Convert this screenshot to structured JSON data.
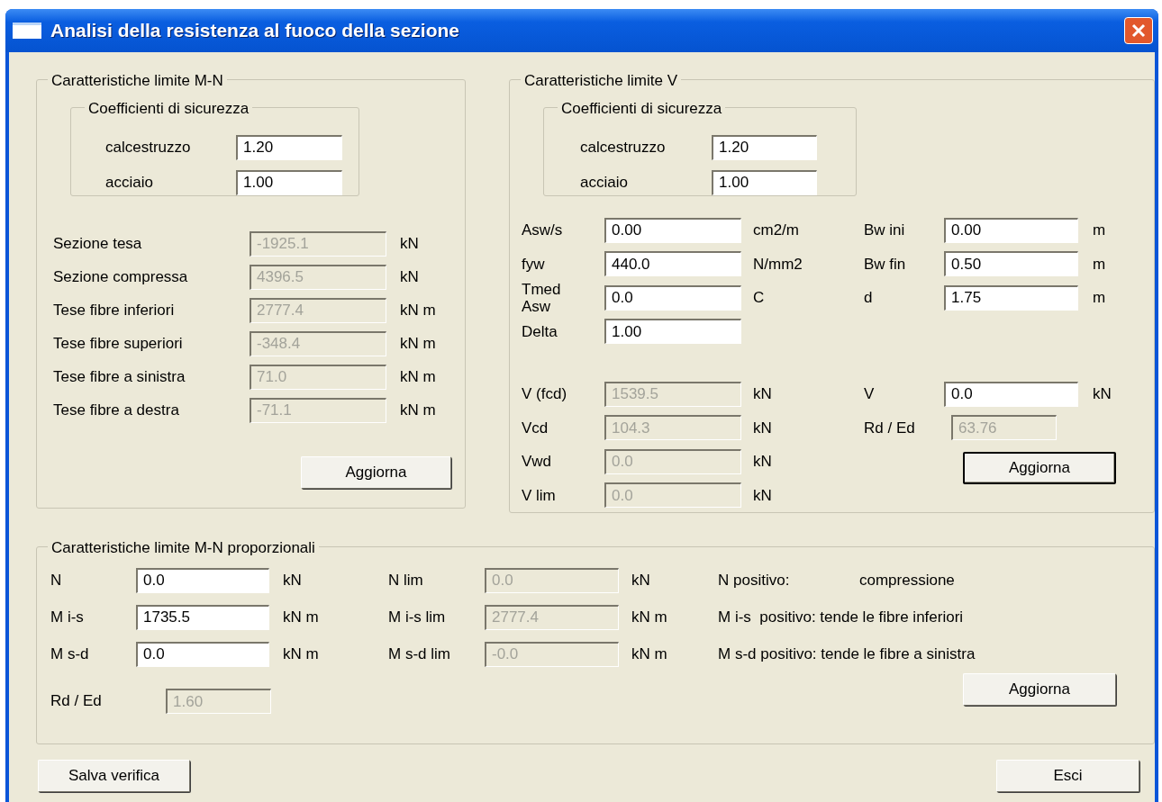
{
  "window": {
    "title": "Analisi della resistenza al fuoco della sezione"
  },
  "mn_limits": {
    "title": "Caratteristiche limite M-N",
    "safety_coefficients": {
      "title": "Coefficienti di sicurezza",
      "fields": [
        {
          "label": "calcestruzzo",
          "value": "1.20",
          "disabled": false
        },
        {
          "label": "acciaio",
          "value": "1.00",
          "disabled": false
        }
      ]
    },
    "results": [
      {
        "label": "Sezione tesa",
        "value": "-1925.1",
        "unit": "kN",
        "disabled": true
      },
      {
        "label": "Sezione compressa",
        "value": "4396.5",
        "unit": "kN",
        "disabled": true
      },
      {
        "label": "Tese fibre inferiori",
        "value": "2777.4",
        "unit": "kN m",
        "disabled": true
      },
      {
        "label": "Tese fibre superiori",
        "value": "-348.4",
        "unit": "kN m",
        "disabled": true
      },
      {
        "label": "Tese fibre a sinistra",
        "value": "71.0",
        "unit": "kN m",
        "disabled": true
      },
      {
        "label": "Tese fibre a destra",
        "value": "-71.1",
        "unit": "kN m",
        "disabled": true
      }
    ],
    "button": {
      "label": "Aggiorna",
      "default": false
    }
  },
  "v_limits": {
    "title": "Caratteristiche limite V",
    "safety_coefficients": {
      "title": "Coefficienti di sicurezza",
      "fields": [
        {
          "label": "calcestruzzo",
          "value": "1.20",
          "disabled": false
        },
        {
          "label": "acciaio",
          "value": "1.00",
          "disabled": false
        }
      ]
    },
    "inputs_left": [
      {
        "label": "Asw/s",
        "value": "0.00",
        "unit": "cm2/m",
        "disabled": false
      },
      {
        "label": "fyw",
        "value": "440.0",
        "unit": "N/mm2",
        "disabled": false
      },
      {
        "label": "Tmed Asw",
        "value": "0.0",
        "unit": "C",
        "disabled": false
      },
      {
        "label": "Delta",
        "value": "1.00",
        "disabled": false
      }
    ],
    "inputs_right": [
      {
        "label": "Bw ini",
        "value": "0.00",
        "unit": "m",
        "disabled": false
      },
      {
        "label": "Bw fin",
        "value": "0.50",
        "unit": "m",
        "disabled": false
      },
      {
        "label": "d",
        "value": "1.75",
        "unit": "m",
        "disabled": false
      }
    ],
    "results_left": [
      {
        "label": "V (fcd)",
        "value": "1539.5",
        "unit": "kN",
        "disabled": true
      },
      {
        "label": "Vcd",
        "value": "104.3",
        "unit": "kN",
        "disabled": true
      },
      {
        "label": "Vwd",
        "value": "0.0",
        "unit": "kN",
        "disabled": true
      },
      {
        "label": "V lim",
        "value": "0.0",
        "unit": "kN",
        "disabled": true
      }
    ],
    "results_right": [
      {
        "label": "V",
        "value": "0.0",
        "unit": "kN",
        "disabled": false
      },
      {
        "label": "Rd / Ed",
        "value": "63.76",
        "disabled": true
      }
    ],
    "button": {
      "label": "Aggiorna",
      "default": true
    }
  },
  "mn_proportional": {
    "title": "Caratteristiche limite M-N proporzionali",
    "rows": [
      {
        "input": {
          "label": "N",
          "value": "0.0",
          "unit": "kN",
          "disabled": false
        },
        "limit": {
          "label": "N lim",
          "value": "0.0",
          "unit": "kN",
          "disabled": true
        },
        "note": [
          "N positivo:",
          "compressione"
        ]
      },
      {
        "input": {
          "label": "M i-s",
          "value": "1735.5",
          "unit": "kN m",
          "disabled": false
        },
        "limit": {
          "label": "M i-s lim",
          "value": "2777.4",
          "unit": "kN m",
          "disabled": true
        },
        "note": [
          "M i-s  positivo: tende le fibre inferiori"
        ]
      },
      {
        "input": {
          "label": "M s-d",
          "value": "0.0",
          "unit": "kN m",
          "disabled": false
        },
        "limit": {
          "label": "M s-d lim",
          "value": "-0.0",
          "unit": "kN m",
          "disabled": true
        },
        "note": [
          "M s-d positivo: tende le fibre a sinistra"
        ]
      }
    ],
    "ratio": {
      "label": "Rd / Ed",
      "value": "1.60",
      "disabled": true
    },
    "button": {
      "label": "Aggiorna",
      "default": false
    }
  },
  "footer_buttons": [
    {
      "label": "Salva verifica",
      "default": false
    },
    {
      "label": "Esci",
      "default": false
    }
  ]
}
